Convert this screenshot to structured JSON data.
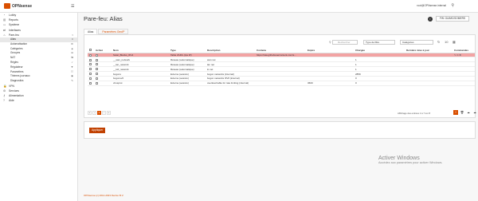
{
  "topbar": {
    "logo_text": "OPNsense",
    "menu_icon": "hamburger-icon",
    "user": "root@OPNsense.internal",
    "search_icon": "search-icon"
  },
  "sidebar": {
    "items": [
      {
        "icon": "gauge-icon",
        "label": "Lobby"
      },
      {
        "icon": "chart-icon",
        "label": "Reports"
      },
      {
        "icon": "computer-icon",
        "label": "Système"
      },
      {
        "icon": "network-icon",
        "label": "Interfaces"
      },
      {
        "icon": "fire-icon",
        "label": "Pare-feu"
      }
    ],
    "sub_items": [
      {
        "label": "Alias",
        "icon": "list-icon",
        "active": true
      },
      {
        "label": "Automatisation",
        "icon": "gear-icon"
      },
      {
        "label": "Catégories",
        "icon": "tag-icon"
      },
      {
        "label": "Groupes",
        "icon": "sitemap-icon"
      },
      {
        "label": "NAT",
        "icon": "exchange-icon"
      },
      {
        "label": "Règles",
        "icon": "check-icon"
      },
      {
        "label": "Régulateur",
        "icon": "filter-icon"
      },
      {
        "label": "Paramètres",
        "icon": "sliders-icon"
      },
      {
        "label": "Thèmes journaux",
        "icon": "eye-icon"
      },
      {
        "label": "Diagnostics",
        "icon": "wrench-icon"
      }
    ],
    "more_items": [
      {
        "icon": "lock-icon",
        "label": "VPN"
      },
      {
        "icon": "cog-icon",
        "label": "Services"
      },
      {
        "icon": "key-icon",
        "label": "Alimentation"
      },
      {
        "icon": "help-icon",
        "label": "Aide"
      }
    ]
  },
  "main": {
    "title": "Pare-feu: Alias",
    "help_icon": "i",
    "fw_badge": "FW: GUIMC/SOMERS",
    "tabs": [
      "Alias",
      "Paramètres GeoIP"
    ],
    "toolbar": {
      "search_placeholder": "Rechercher",
      "type_filter": "Type de filtre",
      "category_filter": "Catégories",
      "add_label": "+"
    },
    "columns": [
      "",
      "Activé",
      "Nom",
      "Type",
      "Description",
      "Contenu",
      "Expire",
      "Chargée",
      "Dernière mise à jour",
      "Commandes"
    ],
    "rows": [
      {
        "selected": true,
        "name": "Solar_Blocks_IPv4",
        "type": "Table d'URL (Ips IP)",
        "description": "",
        "content": "https://raw.githubusercontent.com/s...",
        "expire": "",
        "loaded": "",
        "updated": ""
      },
      {
        "selected": false,
        "name": "__wan_network",
        "type": "Réseau (automatique)",
        "description": "wan net",
        "content": "",
        "expire": "",
        "loaded": "1",
        "updated": ""
      },
      {
        "selected": false,
        "name": "__lan_network",
        "type": "Réseau (automatique)",
        "description": "lan net",
        "content": "",
        "expire": "",
        "loaded": "1",
        "updated": ""
      },
      {
        "selected": false,
        "name": "__lo0_network",
        "type": "Réseau (automatique)",
        "description": "lo net",
        "content": "",
        "expire": "",
        "loaded": "1",
        "updated": ""
      },
      {
        "selected": false,
        "name": "bogons",
        "type": "Externe (avancé)",
        "description": "bogon networks (internal)",
        "content": "",
        "expire": "",
        "loaded": "2859",
        "updated": ""
      },
      {
        "selected": false,
        "name": "bogonsv6",
        "type": "Externe (avancé)",
        "description": "bogon networks IPv6 (internal)",
        "content": "",
        "expire": "",
        "loaded": "0",
        "updated": ""
      },
      {
        "selected": false,
        "name": "virusprot",
        "type": "Externe (avancé)",
        "description": "overload table for rate limiting (internal)",
        "content": "",
        "expire": "3600",
        "loaded": "0",
        "updated": ""
      }
    ],
    "pager": [
      "«",
      "‹",
      "1",
      "›",
      "»"
    ],
    "pager_info": "Affichage des entrées 1 à 7 sur 8",
    "apply_label": "Appliquer"
  },
  "footer": {
    "text": "OPNsense (c) 2014-2023 Deciso B.V."
  },
  "watermark": {
    "line1": "Activer Windows",
    "line2": "Accédez aux paramètres pour activer Windows."
  },
  "colors": {
    "accent": "#d94f00",
    "selected_row": "#f2a3a3",
    "apply": "#c14101"
  }
}
